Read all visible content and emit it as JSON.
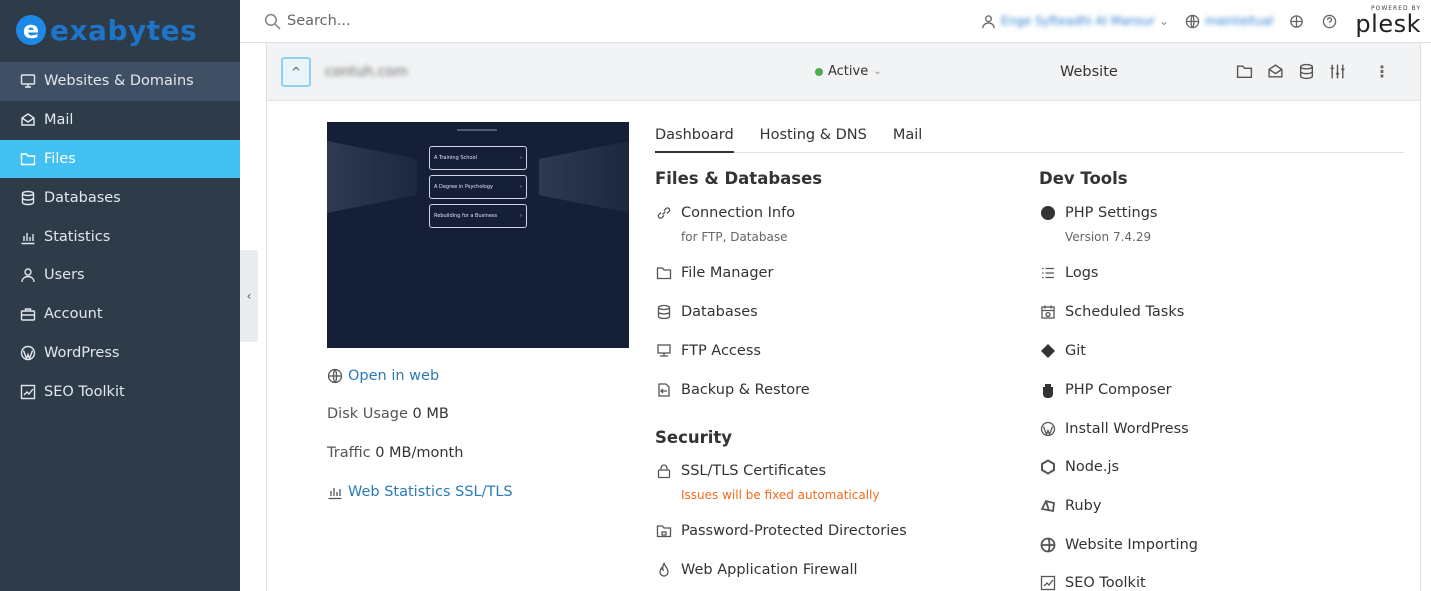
{
  "brand": {
    "logo_letter": "e",
    "logo_text": "exabytes",
    "color": "#1e74c8"
  },
  "sidebar": {
    "items": [
      {
        "label": "Websites & Domains",
        "icon": "monitor-icon",
        "state": "selected"
      },
      {
        "label": "Mail",
        "icon": "envelope-icon",
        "state": ""
      },
      {
        "label": "Files",
        "icon": "folder-icon",
        "state": "active"
      },
      {
        "label": "Databases",
        "icon": "database-icon",
        "state": ""
      },
      {
        "label": "Statistics",
        "icon": "chart-icon",
        "state": ""
      },
      {
        "label": "Users",
        "icon": "user-icon",
        "state": ""
      },
      {
        "label": "Account",
        "icon": "briefcase-icon",
        "state": ""
      },
      {
        "label": "WordPress",
        "icon": "wordpress-icon",
        "state": ""
      },
      {
        "label": "SEO Toolkit",
        "icon": "seo-icon",
        "state": ""
      }
    ],
    "active_color": "#42c0f2"
  },
  "topbar": {
    "search_placeholder": "Search...",
    "user_name": "Enge Syfteadhi Al Mansur",
    "subscription": "mainteitual",
    "powered_by": "POWERED BY",
    "plesk": "plesk"
  },
  "domain": {
    "name": "contuh.com",
    "status": "Active",
    "status_color": "#4caf50",
    "type": "Website"
  },
  "preview": {
    "buttons": [
      "A Training School",
      "A Degree in Psychology",
      "Rebuilding for a Business"
    ]
  },
  "info": {
    "open_in_web": "Open in web",
    "disk_usage_label": "Disk Usage",
    "disk_usage_value": "0 MB",
    "traffic_label": "Traffic",
    "traffic_value": "0 MB/month",
    "web_stats": "Web Statistics SSL/TLS"
  },
  "tabs": [
    "Dashboard",
    "Hosting & DNS",
    "Mail"
  ],
  "files_databases": {
    "title": "Files & Databases",
    "tools": [
      {
        "label": "Connection Info",
        "sub": "for FTP, Database"
      },
      {
        "label": "File Manager"
      },
      {
        "label": "Databases"
      },
      {
        "label": "FTP Access"
      },
      {
        "label": "Backup & Restore"
      }
    ]
  },
  "security": {
    "title": "Security",
    "tools": [
      {
        "label": "SSL/TLS Certificates",
        "sub": "Issues will be fixed automatically"
      },
      {
        "label": "Password-Protected Directories"
      },
      {
        "label": "Web Application Firewall"
      }
    ]
  },
  "dev_tools": {
    "title": "Dev Tools",
    "tools": [
      {
        "label": "PHP Settings",
        "sub": "Version 7.4.29"
      },
      {
        "label": "Logs"
      },
      {
        "label": "Scheduled Tasks"
      },
      {
        "label": "Git"
      },
      {
        "label": "PHP Composer"
      },
      {
        "label": "Install WordPress"
      },
      {
        "label": "Node.js"
      },
      {
        "label": "Ruby"
      },
      {
        "label": "Website Importing"
      },
      {
        "label": "SEO Toolkit"
      }
    ]
  }
}
